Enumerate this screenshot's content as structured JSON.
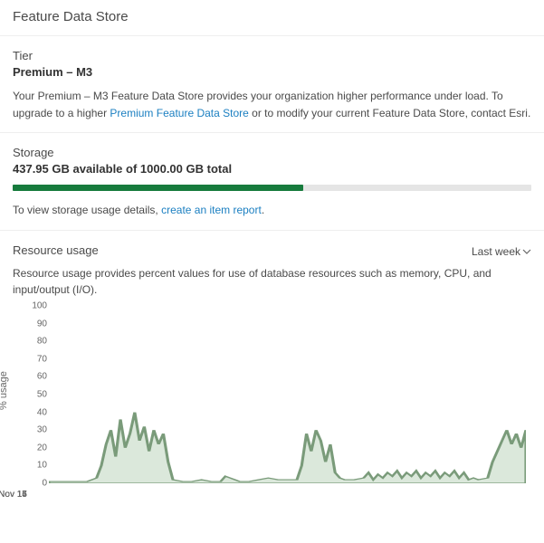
{
  "page_title": "Feature Data Store",
  "tier": {
    "label": "Tier",
    "value": "Premium – M3",
    "desc_prefix": "Your Premium – M3 Feature Data Store provides your organization higher performance under load. To upgrade to a higher ",
    "desc_link": "Premium Feature Data Store",
    "desc_suffix": " or to modify your current Feature Data Store, contact Esri."
  },
  "storage": {
    "label": "Storage",
    "summary": "437.95 GB available of 1000.00 GB total",
    "percent_used": 56,
    "report_prefix": "To view storage usage details, ",
    "report_link": "create an item report",
    "report_suffix": "."
  },
  "resource": {
    "label": "Resource usage",
    "range_label": "Last week",
    "desc": "Resource usage provides percent values for use of database resources such as memory, CPU, and input/output (I/O)."
  },
  "chart_data": {
    "type": "area",
    "ylabel": "% usage",
    "xlabel": "",
    "ylim": [
      0,
      100
    ],
    "yticks": [
      0,
      10,
      20,
      30,
      40,
      50,
      60,
      70,
      80,
      90,
      100
    ],
    "x_ticks": [
      "Nov 14",
      "Nov 15",
      "Nov 16",
      "Nov 17"
    ],
    "x_tick_positions": [
      20,
      40,
      60,
      80
    ],
    "series": [
      {
        "name": "usage-percent",
        "x": [
          0,
          2,
          4,
          6,
          8,
          10,
          11,
          12,
          13,
          14,
          15,
          16,
          17,
          18,
          19,
          20,
          21,
          22,
          23,
          24,
          25,
          26,
          28,
          30,
          32,
          34,
          36,
          37,
          38,
          39,
          40,
          42,
          44,
          46,
          48,
          50,
          52,
          53,
          54,
          55,
          56,
          57,
          58,
          59,
          60,
          61,
          62,
          64,
          66,
          67,
          68,
          69,
          70,
          71,
          72,
          73,
          74,
          75,
          76,
          77,
          78,
          79,
          80,
          81,
          82,
          83,
          84,
          85,
          86,
          87,
          88,
          89,
          90,
          92,
          93,
          94,
          95,
          96,
          97,
          98,
          99,
          100
        ],
        "values": [
          1,
          1,
          1,
          1,
          1,
          3,
          10,
          22,
          30,
          15,
          36,
          20,
          28,
          40,
          24,
          32,
          18,
          30,
          22,
          28,
          12,
          2,
          1,
          1,
          2,
          1,
          1,
          4,
          3,
          2,
          1,
          1,
          2,
          3,
          2,
          2,
          2,
          10,
          28,
          18,
          30,
          24,
          12,
          22,
          6,
          3,
          2,
          2,
          3,
          6,
          2,
          5,
          3,
          6,
          4,
          7,
          3,
          6,
          4,
          7,
          3,
          6,
          4,
          7,
          3,
          6,
          4,
          7,
          3,
          6,
          2,
          3,
          2,
          3,
          12,
          18,
          24,
          30,
          22,
          28,
          20,
          30
        ]
      }
    ]
  }
}
